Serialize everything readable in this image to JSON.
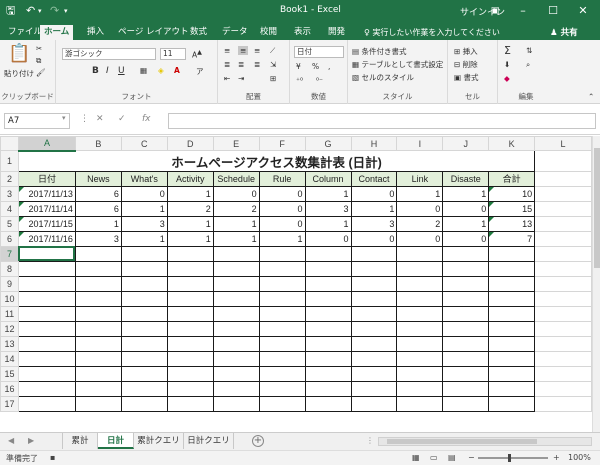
{
  "window": {
    "title": "Book1  -  Excel",
    "signin": "サインイン",
    "colors": {
      "accent": "#217346",
      "header_fill": "#e2efda"
    }
  },
  "ribbon_tabs": [
    "ファイル",
    "ホーム",
    "挿入",
    "ページ レイアウト",
    "数式",
    "データ",
    "校閲",
    "表示",
    "開発"
  ],
  "active_tab": "ホーム",
  "tell_me": "実行したい作業を入力してください",
  "share": "共有",
  "ribbon": {
    "clipboard": {
      "label": "クリップボード",
      "paste": "貼り付け"
    },
    "font": {
      "label": "フォント",
      "name": "游ゴシック",
      "size": "11",
      "bold": "B",
      "italic": "I",
      "underline": "U"
    },
    "alignment": {
      "label": "配置"
    },
    "number": {
      "label": "数値",
      "format": "日付",
      "percent": "%",
      "comma": ","
    },
    "styles": {
      "label": "スタイル",
      "conditional": "条件付き書式",
      "as_table": "テーブルとして書式設定",
      "cell_styles": "セルのスタイル"
    },
    "cells": {
      "label": "セル",
      "insert": "挿入",
      "delete": "削除",
      "format": "書式"
    },
    "editing": {
      "label": "編集",
      "sum": "Σ"
    }
  },
  "formula_bar": {
    "name_box": "A7",
    "cancel": "✕",
    "enter": "✓",
    "fx": "fx",
    "content": ""
  },
  "sheet": {
    "columns": [
      "A",
      "B",
      "C",
      "D",
      "E",
      "F",
      "G",
      "H",
      "I",
      "J",
      "K",
      "L"
    ],
    "active_col": "A",
    "active_row": 7,
    "title": "ホームページアクセス数集計表 (日計)",
    "headers": [
      "日付",
      "News",
      "What's",
      "Activity",
      "Schedule",
      "Rule",
      "Column",
      "Contact",
      "Link",
      "Disaste",
      "合計"
    ],
    "rows": [
      [
        "2017/11/13",
        "6",
        "0",
        "1",
        "0",
        "0",
        "1",
        "0",
        "1",
        "1",
        "10"
      ],
      [
        "2017/11/14",
        "6",
        "1",
        "2",
        "2",
        "0",
        "3",
        "1",
        "0",
        "0",
        "15"
      ],
      [
        "2017/11/15",
        "1",
        "3",
        "1",
        "1",
        "0",
        "1",
        "3",
        "2",
        "1",
        "13"
      ],
      [
        "2017/11/16",
        "3",
        "1",
        "1",
        "1",
        "1",
        "0",
        "0",
        "0",
        "0",
        "7"
      ]
    ],
    "row_numbers": [
      "1",
      "2",
      "3",
      "4",
      "5",
      "6",
      "7",
      "8",
      "9",
      "10",
      "11",
      "12",
      "13",
      "14",
      "15",
      "16",
      "17"
    ]
  },
  "sheet_tabs": [
    "累計",
    "日計",
    "累計クエリ",
    "日計クエリ"
  ],
  "active_sheet": "日計",
  "status": {
    "ready": "準備完了",
    "zoom": "100%",
    "zoom_minus": "−",
    "zoom_plus": "+"
  }
}
